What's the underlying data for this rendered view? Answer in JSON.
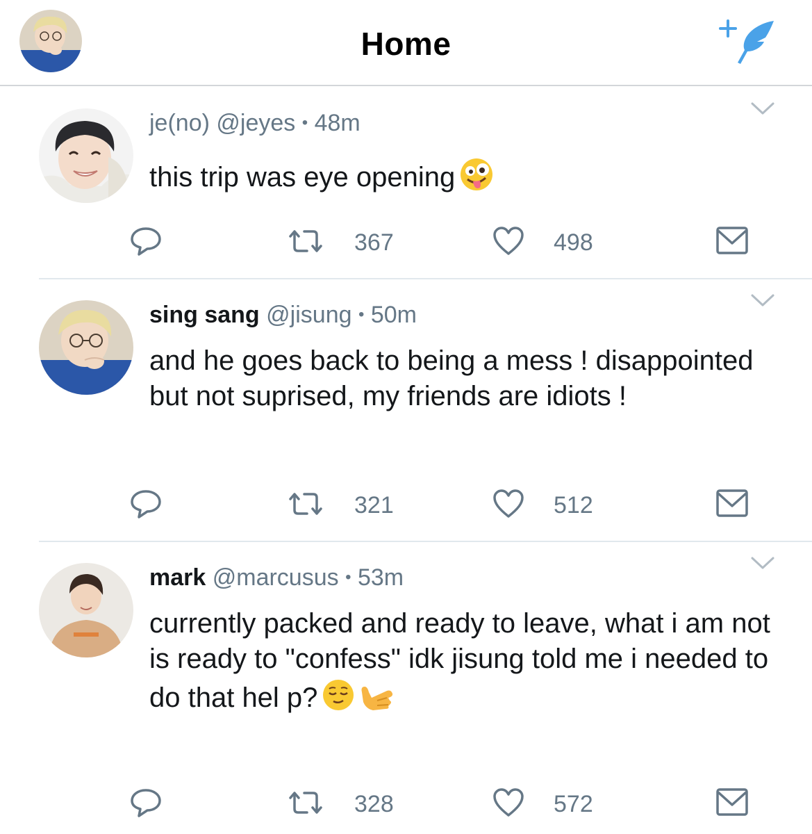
{
  "header": {
    "title": "Home",
    "avatar_icon": "profile-avatar",
    "compose_icon": "compose-quill-icon",
    "accent_color": "#4aa2e8"
  },
  "tweets": [
    {
      "name": "je(no)",
      "handle": "@jeyes",
      "separator": "•",
      "time": "48m",
      "text": "this trip was eye opening",
      "emoji": [
        "zany-face-emoji"
      ],
      "retweets": "367",
      "likes": "498"
    },
    {
      "name": "sing sang",
      "handle": "@jisung",
      "separator": "•",
      "time": "50m",
      "text": "and he goes back to being a mess ! disappointed but not suprised, my friends are idiots !",
      "retweets": "321",
      "likes": "512"
    },
    {
      "name": "mark",
      "handle": "@marcusus",
      "separator": "•",
      "time": "53m",
      "text": "currently packed and ready to leave, what i am not is ready to \"confess\" idk jisung told me i needed to do that hel p?",
      "emoji": [
        "relieved-face-emoji",
        "call-me-hand-emoji"
      ],
      "retweets": "328",
      "likes": "572"
    }
  ],
  "icons": {
    "reply": "reply-icon",
    "retweet": "retweet-icon",
    "like": "heart-icon",
    "dm": "envelope-icon",
    "caret": "chevron-down-icon"
  },
  "colors": {
    "icon_gray": "#657786",
    "divider": "#e1e8ed"
  }
}
